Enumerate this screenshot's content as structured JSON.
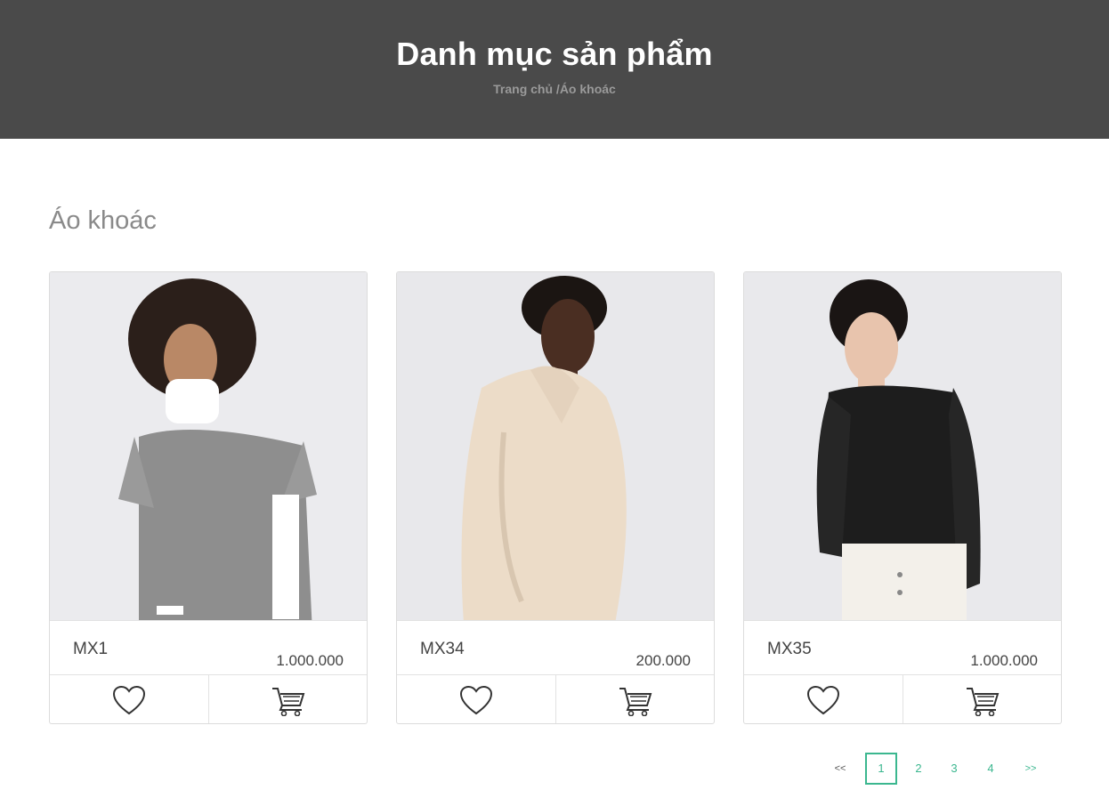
{
  "header": {
    "title": "Danh mục sản phẩm",
    "breadcrumb": "Trang chủ /Áo khoác"
  },
  "category_title": "Áo khoác",
  "products": [
    {
      "name": "MX1",
      "price": "1.000.000",
      "like_icon": "heart-icon",
      "cart_icon": "cart-icon"
    },
    {
      "name": "MX34",
      "price": "200.000",
      "like_icon": "heart-icon",
      "cart_icon": "cart-icon"
    },
    {
      "name": "MX35",
      "price": "1.000.000",
      "like_icon": "heart-icon",
      "cart_icon": "cart-icon"
    }
  ],
  "pagination": {
    "prev": "<<",
    "pages": [
      "1",
      "2",
      "3",
      "4"
    ],
    "next": ">>",
    "current": "1"
  },
  "colors": {
    "header_bg": "#4a4a4a",
    "accent": "#3bb78f"
  }
}
